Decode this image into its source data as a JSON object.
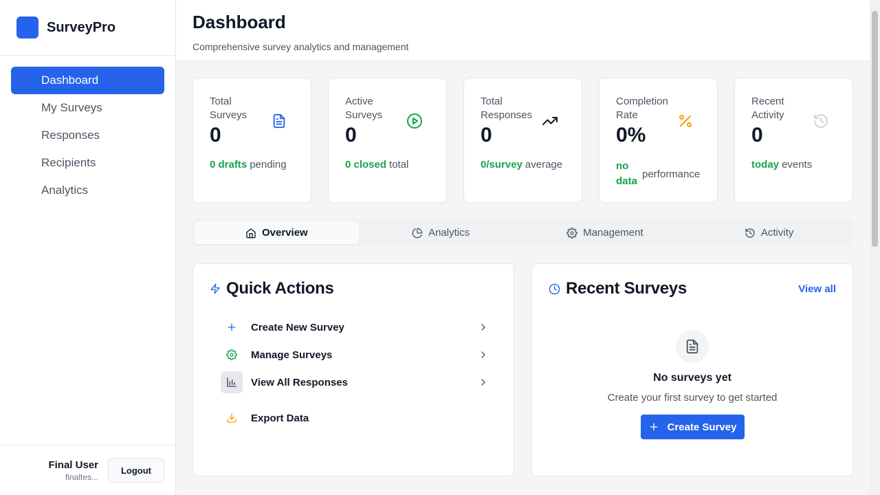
{
  "brand": {
    "name": "SurveyPro",
    "accent": "#2563eb"
  },
  "sidebar": {
    "items": [
      {
        "label": "Dashboard",
        "active": true
      },
      {
        "label": "My Surveys"
      },
      {
        "label": "Responses"
      },
      {
        "label": "Recipients"
      },
      {
        "label": "Analytics"
      }
    ]
  },
  "user": {
    "name": "Final User",
    "email": "finaltes...",
    "logout_label": "Logout"
  },
  "header": {
    "title": "Dashboard",
    "subtitle": "Comprehensive survey analytics and management"
  },
  "stats": [
    {
      "label": "Total Surveys",
      "value": "0",
      "highlight": "0 drafts",
      "suffix": "pending",
      "icon": "file-text-icon"
    },
    {
      "label": "Active Surveys",
      "value": "0",
      "highlight": "0 closed",
      "suffix": "total",
      "icon": "play-circle-icon"
    },
    {
      "label": "Total Responses",
      "value": "0",
      "highlight": "0/survey",
      "suffix": "average",
      "icon": "trending-up-icon"
    },
    {
      "label": "Completion Rate",
      "value": "0%",
      "highlight": "no data",
      "suffix": "performance",
      "icon": "percent-icon"
    },
    {
      "label": "Recent Activity",
      "value": "0",
      "highlight": "today",
      "suffix": "events",
      "icon": "history-icon"
    }
  ],
  "tabs": [
    {
      "label": "Overview",
      "icon": "home-icon",
      "active": true
    },
    {
      "label": "Analytics",
      "icon": "pie-chart-icon"
    },
    {
      "label": "Management",
      "icon": "gear-icon"
    },
    {
      "label": "Activity",
      "icon": "history-icon"
    }
  ],
  "quick_actions": {
    "title": "Quick Actions",
    "items": [
      {
        "label": "Create New Survey",
        "icon": "plus-icon"
      },
      {
        "label": "Manage Surveys",
        "icon": "gear-icon"
      },
      {
        "label": "View All Responses",
        "icon": "bar-chart-icon"
      },
      {
        "label": "Export Data",
        "icon": "download-icon"
      }
    ]
  },
  "recent_surveys": {
    "title": "Recent Surveys",
    "view_all": "View all",
    "empty_title": "No surveys yet",
    "empty_sub": "Create your first survey to get started",
    "create_label": "Create Survey"
  }
}
